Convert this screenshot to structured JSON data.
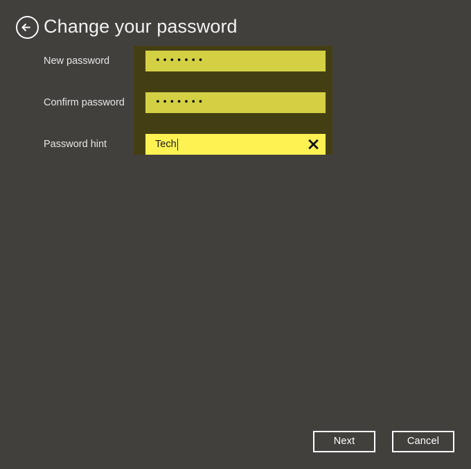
{
  "header": {
    "title": "Change your password",
    "back_icon": "back-arrow-circle-icon"
  },
  "form": {
    "fields": [
      {
        "label": "New password",
        "type": "password",
        "value": "•••••••",
        "masked_char_count": 7,
        "focused": false
      },
      {
        "label": "Confirm password",
        "type": "password",
        "value": "•••••••",
        "masked_char_count": 7,
        "focused": false
      },
      {
        "label": "Password hint",
        "type": "text",
        "value": "Tech",
        "focused": true,
        "clear_icon": "clear-x-icon"
      }
    ]
  },
  "footer": {
    "next_label": "Next",
    "cancel_label": "Cancel"
  },
  "colors": {
    "background": "#42403d",
    "panel": "#443f12",
    "input": "#d4d044",
    "input_focused": "#fdf252",
    "text_light": "#f2f2f2",
    "text_dark": "#1a1a1a",
    "button_border": "#ffffff"
  }
}
